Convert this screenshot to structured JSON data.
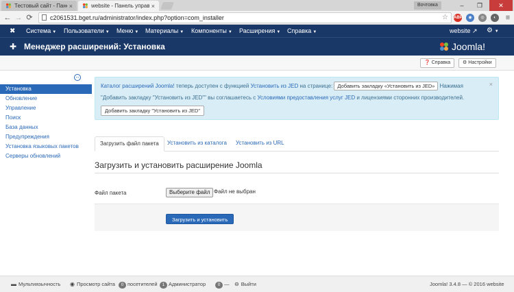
{
  "browser": {
    "tabs": [
      {
        "label": "Тестовый сайт - Панель",
        "active": false
      },
      {
        "label": "website - Панель управ",
        "active": true
      }
    ],
    "profile": "Вочтовка",
    "url": "c2061531.bget.ru/administrator/index.php?option=com_installer",
    "win_min": "–",
    "win_max": "❐",
    "win_close": "✕"
  },
  "topbar": {
    "menu": [
      "Система",
      "Пользователи",
      "Меню",
      "Материалы",
      "Компоненты",
      "Расширения",
      "Справка"
    ],
    "site_link": "website"
  },
  "header": {
    "title": "Менеджер расширений: Установка",
    "brand": "Joomla!"
  },
  "toolbar": {
    "help": "Справка",
    "options": "Настройки"
  },
  "sidebar": {
    "items": [
      {
        "label": "Установка",
        "active": true
      },
      {
        "label": "Обновление"
      },
      {
        "label": "Управление"
      },
      {
        "label": "Поиск"
      },
      {
        "label": "База данных"
      },
      {
        "label": "Предупреждения"
      },
      {
        "label": "Установка языковых пакетов"
      },
      {
        "label": "Серверы обновлений"
      }
    ]
  },
  "message": {
    "l1_link1": "Каталог расширений Joomla!",
    "l1_text1": " теперь доступен с функцией ",
    "l1_link2": "Установить из JED",
    "l1_text2": " на странице: ",
    "l1_button": "Добавить закладку «Установить из JED»",
    "l1_text3": " Нажимая",
    "l2_text1": "\"Добавить закладку \"Установить из JED\"\" вы соглашаетесь с ",
    "l2_link": "Условиями предоставления услуг JED",
    "l2_text2": " и лицензиями сторонних производителей.",
    "button2": "Добавить закладку \"Установить из JED\"",
    "close": "×"
  },
  "tabs": [
    "Загрузить файл пакета",
    "Установить из каталога",
    "Установить из URL"
  ],
  "form": {
    "section_title": "Загрузить и установить расширение Joomla",
    "file_label": "Файл пакета",
    "file_button": "Выберите файл",
    "file_status": "Файл не выбран",
    "submit": "Загрузить и установить"
  },
  "statusbar": {
    "multilang": "Мультиязычность",
    "view_site": "Просмотр сайта",
    "visitors_count": "0",
    "visitors": "посетителей",
    "admins_count": "1",
    "admins": "Администратор",
    "messages_count": "0",
    "dash": "—",
    "logout": "Выйти",
    "version": "Joomla! 3.4.8 — © 2016 website"
  }
}
